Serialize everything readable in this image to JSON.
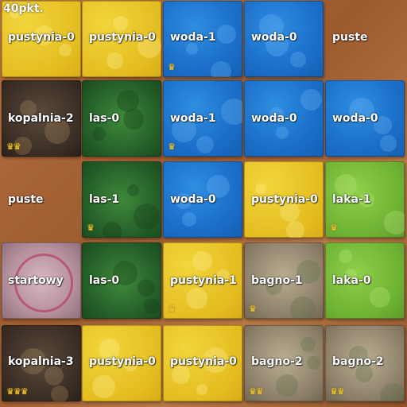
{
  "score": "40pkt.",
  "crown_glyph": "♛",
  "grid": [
    [
      {
        "terrain": "pustynia",
        "label": "pustynia-0",
        "crowns": 0
      },
      {
        "terrain": "pustynia",
        "label": "pustynia-0",
        "crowns": 0
      },
      {
        "terrain": "woda",
        "label": "woda-1",
        "crowns": 1
      },
      {
        "terrain": "woda",
        "label": "woda-0",
        "crowns": 0
      },
      {
        "terrain": "empty",
        "label": "puste",
        "crowns": 0
      }
    ],
    [
      {
        "terrain": "kopalnia",
        "label": "kopalnia-2",
        "crowns": 2
      },
      {
        "terrain": "las",
        "label": "las-0",
        "crowns": 0
      },
      {
        "terrain": "woda",
        "label": "woda-1",
        "crowns": 1
      },
      {
        "terrain": "woda",
        "label": "woda-0",
        "crowns": 0
      },
      {
        "terrain": "woda",
        "label": "woda-0",
        "crowns": 0
      }
    ],
    [
      {
        "terrain": "empty",
        "label": "puste",
        "crowns": 0
      },
      {
        "terrain": "las",
        "label": "las-1",
        "crowns": 1
      },
      {
        "terrain": "woda",
        "label": "woda-0",
        "crowns": 0
      },
      {
        "terrain": "pustynia",
        "label": "pustynia-0",
        "crowns": 0
      },
      {
        "terrain": "laka",
        "label": "laka-1",
        "crowns": 1
      }
    ],
    [
      {
        "terrain": "startowy",
        "label": "startowy",
        "crowns": 0
      },
      {
        "terrain": "las",
        "label": "las-0",
        "crowns": 0
      },
      {
        "terrain": "pustynia",
        "label": "pustynia-1",
        "crowns": 1
      },
      {
        "terrain": "bagno",
        "label": "bagno-1",
        "crowns": 1
      },
      {
        "terrain": "laka",
        "label": "laka-0",
        "crowns": 0
      }
    ],
    [
      {
        "terrain": "kopalnia",
        "label": "kopalnia-3",
        "crowns": 3
      },
      {
        "terrain": "pustynia",
        "label": "pustynia-0",
        "crowns": 0
      },
      {
        "terrain": "pustynia",
        "label": "pustynia-0",
        "crowns": 0
      },
      {
        "terrain": "bagno",
        "label": "bagno-2",
        "crowns": 2
      },
      {
        "terrain": "bagno",
        "label": "bagno-2",
        "crowns": 2
      }
    ]
  ]
}
